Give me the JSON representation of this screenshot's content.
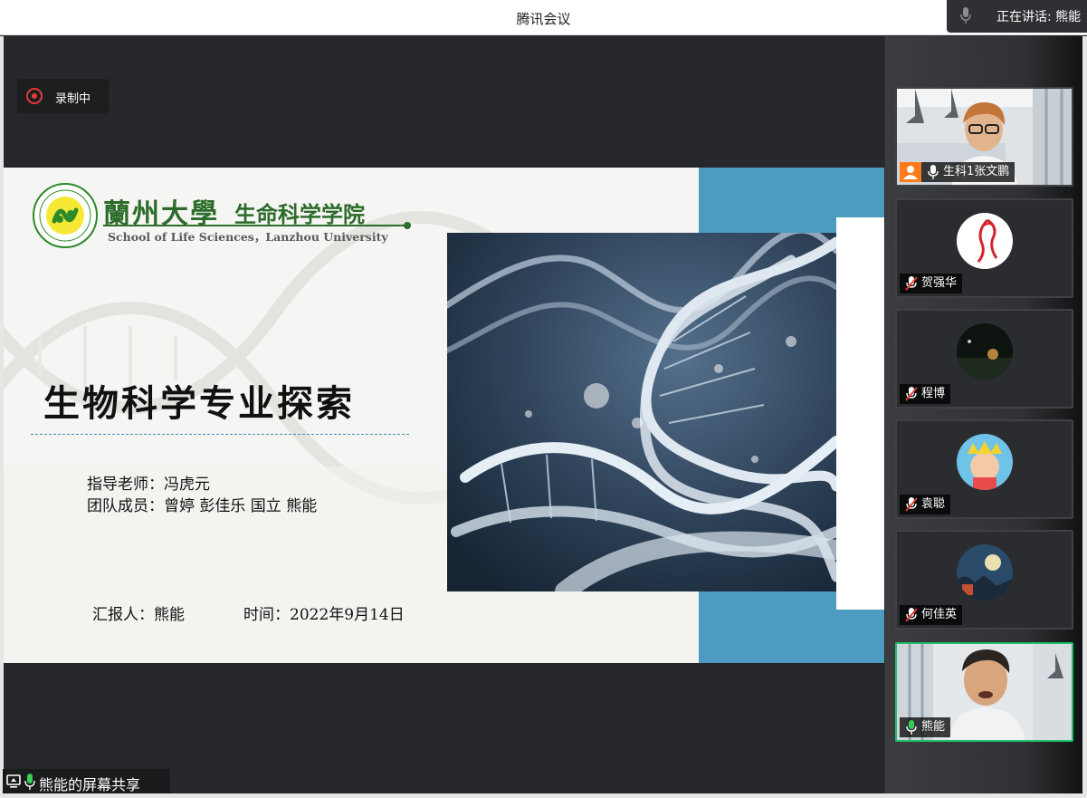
{
  "window": {
    "title": "腾讯会议",
    "speaking_label": "正在讲话: 熊能"
  },
  "recording": {
    "label": "录制中"
  },
  "slide": {
    "logo_cn": "蘭州大學",
    "logo_school": "生命科学学院",
    "logo_en": "School of Life Sciences，Lanzhou University",
    "title": "生物科学专业探索",
    "advisor": "指导老师：冯虎元",
    "members": "团队成员：曾婷 彭佳乐 国立 熊能",
    "reporter": "汇报人：熊能",
    "date": "时间：2022年9月14日"
  },
  "share": {
    "label": "熊能的屏幕共享"
  },
  "participants": [
    {
      "name": "生科1张文鹏",
      "mic": "on",
      "host": true,
      "video": "camera"
    },
    {
      "name": "贺强华",
      "mic": "muted",
      "host": false,
      "video": "avatar"
    },
    {
      "name": "程博",
      "mic": "muted",
      "host": false,
      "video": "avatar"
    },
    {
      "name": "袁聪",
      "mic": "muted",
      "host": false,
      "video": "avatar"
    },
    {
      "name": "何佳英",
      "mic": "muted",
      "host": false,
      "video": "avatar"
    },
    {
      "name": "熊能",
      "mic": "speaking",
      "host": false,
      "video": "camera"
    }
  ],
  "colors": {
    "accent_green": "#1fbf6a",
    "record_red": "#e53935",
    "slide_blue": "#4d9bc0",
    "logo_green": "#2d6b2a"
  }
}
